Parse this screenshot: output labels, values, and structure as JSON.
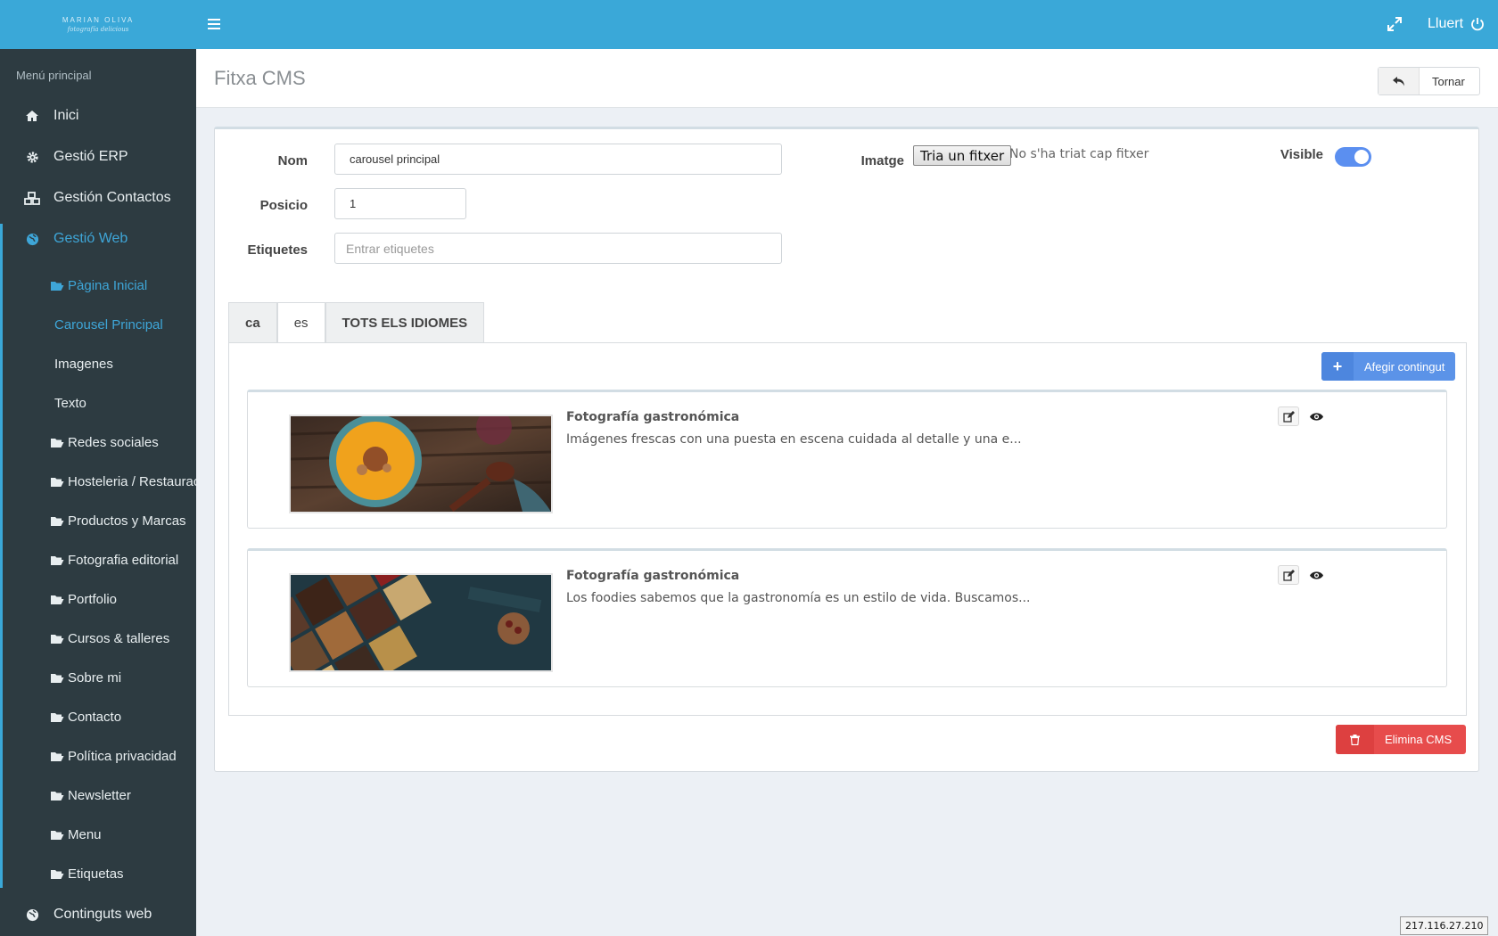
{
  "brand": {
    "line1": "MARIAN OLIVA",
    "line2": "fotografía delicious"
  },
  "topbar": {
    "logout_label": "Lluert"
  },
  "sidebar": {
    "header": "Menú principal",
    "items": [
      {
        "label": "Inici",
        "icon": "home-icon"
      },
      {
        "label": "Gestió ERP",
        "icon": "gear-icon"
      },
      {
        "label": "Gestión Contactos",
        "icon": "cubes-icon"
      },
      {
        "label": "Gestió Web",
        "icon": "globe-icon"
      }
    ],
    "web_items": [
      {
        "label": "Pàgina Inicial",
        "icon": "folder-open-icon"
      },
      {
        "label": "Carousel Principal"
      },
      {
        "label": "Imagenes"
      },
      {
        "label": "Texto"
      },
      {
        "label": "Redes sociales",
        "icon": "folder-open-icon"
      },
      {
        "label": "Hosteleria / Restauración",
        "icon": "folder-open-icon"
      },
      {
        "label": "Productos y Marcas",
        "icon": "folder-open-icon"
      },
      {
        "label": "Fotografia editorial",
        "icon": "folder-open-icon"
      },
      {
        "label": "Portfolio",
        "icon": "folder-open-icon"
      },
      {
        "label": "Cursos & talleres",
        "icon": "folder-open-icon"
      },
      {
        "label": "Sobre mi",
        "icon": "folder-open-icon"
      },
      {
        "label": "Contacto",
        "icon": "folder-open-icon"
      },
      {
        "label": "Política privacidad",
        "icon": "folder-open-icon"
      },
      {
        "label": "Newsletter",
        "icon": "folder-open-icon"
      },
      {
        "label": "Menu",
        "icon": "folder-open-icon"
      },
      {
        "label": "Etiquetas",
        "icon": "folder-open-icon"
      }
    ],
    "last_item": {
      "label": "Continguts web",
      "icon": "globe-icon"
    }
  },
  "page": {
    "title": "Fitxa CMS",
    "back_label": "Tornar"
  },
  "form": {
    "nom_label": "Nom",
    "nom_value": "carousel principal",
    "posicio_label": "Posicio",
    "posicio_value": "1",
    "etiquetes_label": "Etiquetes",
    "etiquetes_placeholder": "Entrar etiquetes",
    "imatge_label": "Imatge",
    "file_button": "Tria un fitxer",
    "file_status": "No s'ha triat cap fitxer",
    "visible_label": "Visible",
    "visible_on": true
  },
  "tabs": [
    {
      "label": "ca"
    },
    {
      "label": "es"
    },
    {
      "label": "TOTS ELS IDIOMES"
    }
  ],
  "content": {
    "add_label": "Afegir contingut",
    "cards": [
      {
        "title": "Fotografía gastronómica",
        "text": "Imágenes frescas con una puesta en escena cuidada al detalle y una e..."
      },
      {
        "title": "Fotografía gastronómica",
        "text": "Los foodies sabemos que la gastronomía es un estilo de vida. Buscamos..."
      }
    ],
    "delete_label": "Elimina CMS"
  },
  "status": {
    "ip": "217.116.27.210"
  },
  "colors": {
    "topbar": "#3aa8d8",
    "sidebar": "#2d3b41",
    "accent": "#3ea6d8",
    "primary": "#5b93e8",
    "danger": "#e74c4c"
  }
}
